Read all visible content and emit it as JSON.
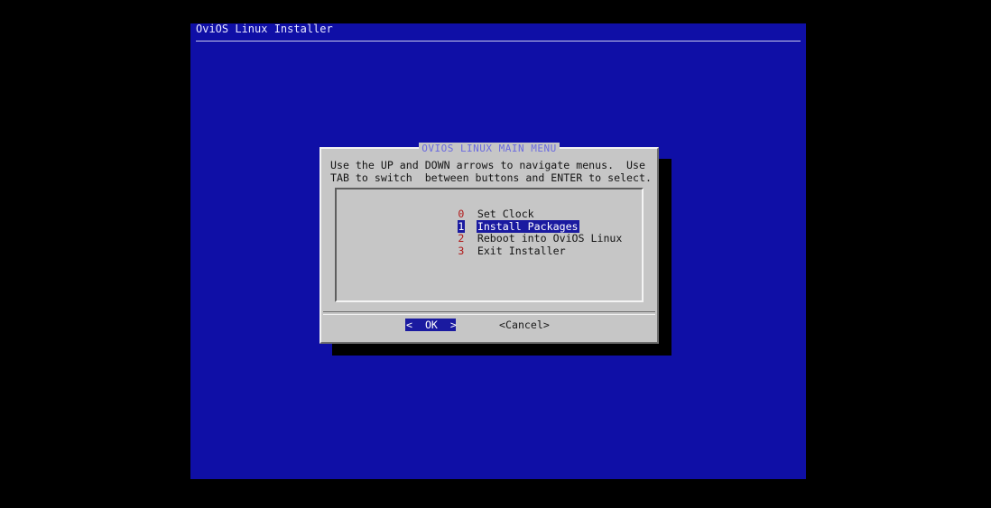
{
  "screen": {
    "backtitle": "OviOS Linux Installer"
  },
  "dialog": {
    "title": "OVIOS LINUX MAIN MENU",
    "prompt_line1": "Use the UP and DOWN arrows to navigate menus.  Use",
    "prompt_line2": "TAB to switch  between buttons and ENTER to select.",
    "menu": {
      "items": [
        {
          "tag": "0",
          "label": "Set Clock",
          "selected": false
        },
        {
          "tag": "1",
          "label": "Install Packages",
          "selected": true
        },
        {
          "tag": "2",
          "label": "Reboot into OviOS Linux",
          "selected": false
        },
        {
          "tag": "3",
          "label": "Exit Installer",
          "selected": false
        }
      ]
    },
    "buttons": {
      "ok_label": "<  OK  >",
      "cancel_label": "<Cancel>",
      "focused": "ok"
    }
  },
  "colors": {
    "background": "#0f0fa6",
    "dialog": "#c6c6c6",
    "highlight": "#1a1aa0",
    "tag": "#b01818",
    "title": "#6a6ae0"
  }
}
